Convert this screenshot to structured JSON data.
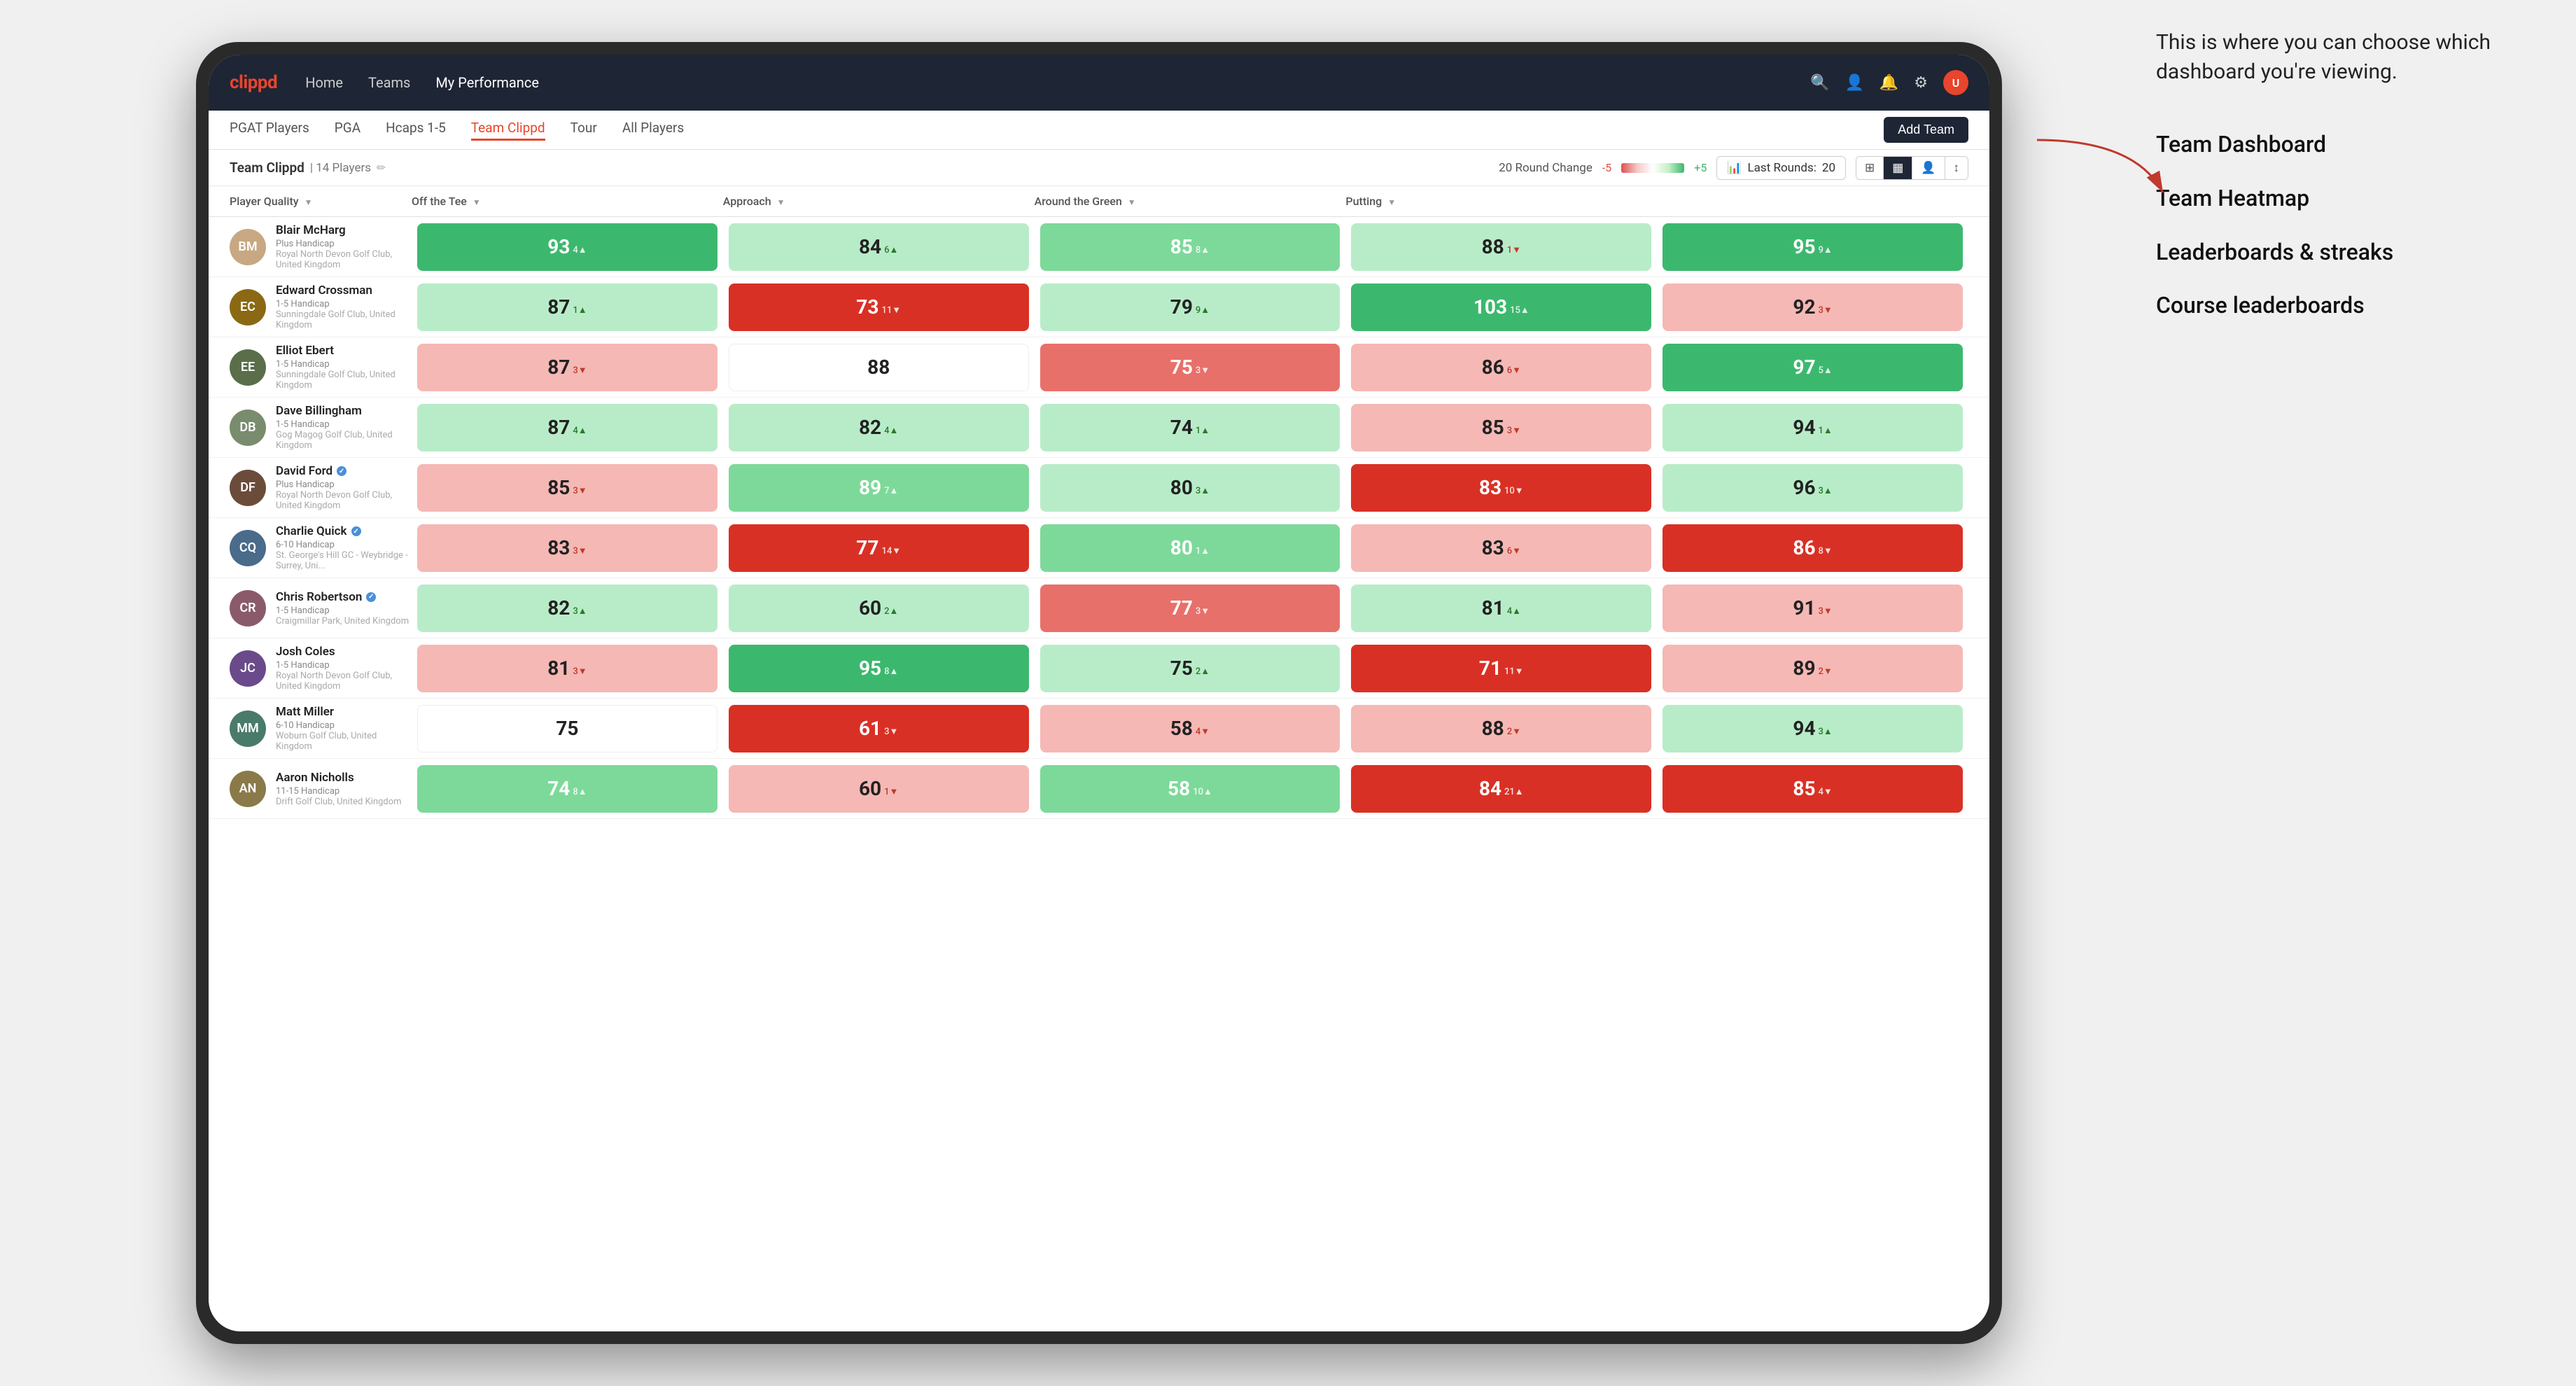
{
  "annotation": {
    "intro": "This is where you can choose which dashboard you're viewing.",
    "menu_items": [
      "Team Dashboard",
      "Team Heatmap",
      "Leaderboards & streaks",
      "Course leaderboards"
    ]
  },
  "navbar": {
    "logo": "clippd",
    "links": [
      "Home",
      "Teams",
      "My Performance"
    ],
    "active_link": "My Performance"
  },
  "subnav": {
    "links": [
      "PGAT Players",
      "PGA",
      "Hcaps 1-5",
      "Team Clippd",
      "Tour",
      "All Players"
    ],
    "active_link": "Team Clippd",
    "add_team_label": "Add Team"
  },
  "team_header": {
    "name": "Team Clippd",
    "separator": "|",
    "count": "14 Players",
    "round_change_label": "20 Round Change",
    "neg_label": "-5",
    "pos_label": "+5",
    "last_rounds_label": "Last Rounds:",
    "last_rounds_value": "20"
  },
  "columns": {
    "headers": [
      {
        "label": "Player Quality",
        "sortable": true
      },
      {
        "label": "Off the Tee",
        "sortable": true
      },
      {
        "label": "Approach",
        "sortable": true
      },
      {
        "label": "Around the Green",
        "sortable": true
      },
      {
        "label": "Putting",
        "sortable": true
      }
    ]
  },
  "players": [
    {
      "name": "Blair McHarg",
      "handicap": "Plus Handicap",
      "club": "Royal North Devon Golf Club, United Kingdom",
      "verified": false,
      "scores": [
        {
          "value": 93,
          "delta": 4,
          "dir": "up",
          "bg": "bg-green-dark"
        },
        {
          "value": 84,
          "delta": 6,
          "dir": "up",
          "bg": "bg-green-light"
        },
        {
          "value": 85,
          "delta": 8,
          "dir": "up",
          "bg": "bg-green-med"
        },
        {
          "value": 88,
          "delta": 1,
          "dir": "down",
          "bg": "bg-green-light"
        },
        {
          "value": 95,
          "delta": 9,
          "dir": "up",
          "bg": "bg-green-dark"
        }
      ]
    },
    {
      "name": "Edward Crossman",
      "handicap": "1-5 Handicap",
      "club": "Sunningdale Golf Club, United Kingdom",
      "verified": false,
      "scores": [
        {
          "value": 87,
          "delta": 1,
          "dir": "up",
          "bg": "bg-green-light"
        },
        {
          "value": 73,
          "delta": 11,
          "dir": "down",
          "bg": "bg-red-dark"
        },
        {
          "value": 79,
          "delta": 9,
          "dir": "up",
          "bg": "bg-green-light"
        },
        {
          "value": 103,
          "delta": 15,
          "dir": "up",
          "bg": "bg-green-dark"
        },
        {
          "value": 92,
          "delta": 3,
          "dir": "down",
          "bg": "bg-red-light"
        }
      ]
    },
    {
      "name": "Elliot Ebert",
      "handicap": "1-5 Handicap",
      "club": "Sunningdale Golf Club, United Kingdom",
      "verified": false,
      "scores": [
        {
          "value": 87,
          "delta": 3,
          "dir": "down",
          "bg": "bg-red-light"
        },
        {
          "value": 88,
          "delta": null,
          "dir": null,
          "bg": "bg-white"
        },
        {
          "value": 75,
          "delta": 3,
          "dir": "down",
          "bg": "bg-red-med"
        },
        {
          "value": 86,
          "delta": 6,
          "dir": "down",
          "bg": "bg-red-light"
        },
        {
          "value": 97,
          "delta": 5,
          "dir": "up",
          "bg": "bg-green-dark"
        }
      ]
    },
    {
      "name": "Dave Billingham",
      "handicap": "1-5 Handicap",
      "club": "Gog Magog Golf Club, United Kingdom",
      "verified": false,
      "scores": [
        {
          "value": 87,
          "delta": 4,
          "dir": "up",
          "bg": "bg-green-light"
        },
        {
          "value": 82,
          "delta": 4,
          "dir": "up",
          "bg": "bg-green-light"
        },
        {
          "value": 74,
          "delta": 1,
          "dir": "up",
          "bg": "bg-green-light"
        },
        {
          "value": 85,
          "delta": 3,
          "dir": "down",
          "bg": "bg-red-light"
        },
        {
          "value": 94,
          "delta": 1,
          "dir": "up",
          "bg": "bg-green-light"
        }
      ]
    },
    {
      "name": "David Ford",
      "handicap": "Plus Handicap",
      "club": "Royal North Devon Golf Club, United Kingdom",
      "verified": true,
      "scores": [
        {
          "value": 85,
          "delta": 3,
          "dir": "down",
          "bg": "bg-red-light"
        },
        {
          "value": 89,
          "delta": 7,
          "dir": "up",
          "bg": "bg-green-med"
        },
        {
          "value": 80,
          "delta": 3,
          "dir": "up",
          "bg": "bg-green-light"
        },
        {
          "value": 83,
          "delta": 10,
          "dir": "down",
          "bg": "bg-red-dark"
        },
        {
          "value": 96,
          "delta": 3,
          "dir": "up",
          "bg": "bg-green-light"
        }
      ]
    },
    {
      "name": "Charlie Quick",
      "handicap": "6-10 Handicap",
      "club": "St. George's Hill GC - Weybridge - Surrey, Uni...",
      "verified": true,
      "scores": [
        {
          "value": 83,
          "delta": 3,
          "dir": "down",
          "bg": "bg-red-light"
        },
        {
          "value": 77,
          "delta": 14,
          "dir": "down",
          "bg": "bg-red-dark"
        },
        {
          "value": 80,
          "delta": 1,
          "dir": "up",
          "bg": "bg-green-med"
        },
        {
          "value": 83,
          "delta": 6,
          "dir": "down",
          "bg": "bg-red-light"
        },
        {
          "value": 86,
          "delta": 8,
          "dir": "down",
          "bg": "bg-red-dark"
        }
      ]
    },
    {
      "name": "Chris Robertson",
      "handicap": "1-5 Handicap",
      "club": "Craigmillar Park, United Kingdom",
      "verified": true,
      "scores": [
        {
          "value": 82,
          "delta": 3,
          "dir": "up",
          "bg": "bg-green-light"
        },
        {
          "value": 60,
          "delta": 2,
          "dir": "up",
          "bg": "bg-green-light"
        },
        {
          "value": 77,
          "delta": 3,
          "dir": "down",
          "bg": "bg-red-med"
        },
        {
          "value": 81,
          "delta": 4,
          "dir": "up",
          "bg": "bg-green-light"
        },
        {
          "value": 91,
          "delta": 3,
          "dir": "down",
          "bg": "bg-red-light"
        }
      ]
    },
    {
      "name": "Josh Coles",
      "handicap": "1-5 Handicap",
      "club": "Royal North Devon Golf Club, United Kingdom",
      "verified": false,
      "scores": [
        {
          "value": 81,
          "delta": 3,
          "dir": "down",
          "bg": "bg-red-light"
        },
        {
          "value": 95,
          "delta": 8,
          "dir": "up",
          "bg": "bg-green-dark"
        },
        {
          "value": 75,
          "delta": 2,
          "dir": "up",
          "bg": "bg-green-light"
        },
        {
          "value": 71,
          "delta": 11,
          "dir": "down",
          "bg": "bg-red-dark"
        },
        {
          "value": 89,
          "delta": 2,
          "dir": "down",
          "bg": "bg-red-light"
        }
      ]
    },
    {
      "name": "Matt Miller",
      "handicap": "6-10 Handicap",
      "club": "Woburn Golf Club, United Kingdom",
      "verified": false,
      "scores": [
        {
          "value": 75,
          "delta": null,
          "dir": null,
          "bg": "bg-white"
        },
        {
          "value": 61,
          "delta": 3,
          "dir": "down",
          "bg": "bg-red-dark"
        },
        {
          "value": 58,
          "delta": 4,
          "dir": "down",
          "bg": "bg-red-light"
        },
        {
          "value": 88,
          "delta": 2,
          "dir": "down",
          "bg": "bg-red-light"
        },
        {
          "value": 94,
          "delta": 3,
          "dir": "up",
          "bg": "bg-green-light"
        }
      ]
    },
    {
      "name": "Aaron Nicholls",
      "handicap": "11-15 Handicap",
      "club": "Drift Golf Club, United Kingdom",
      "verified": false,
      "scores": [
        {
          "value": 74,
          "delta": 8,
          "dir": "up",
          "bg": "bg-green-med"
        },
        {
          "value": 60,
          "delta": 1,
          "dir": "down",
          "bg": "bg-red-light"
        },
        {
          "value": 58,
          "delta": 10,
          "dir": "up",
          "bg": "bg-green-med"
        },
        {
          "value": 84,
          "delta": 21,
          "dir": "up",
          "bg": "bg-red-dark"
        },
        {
          "value": 85,
          "delta": 4,
          "dir": "down",
          "bg": "bg-red-dark"
        }
      ]
    }
  ]
}
